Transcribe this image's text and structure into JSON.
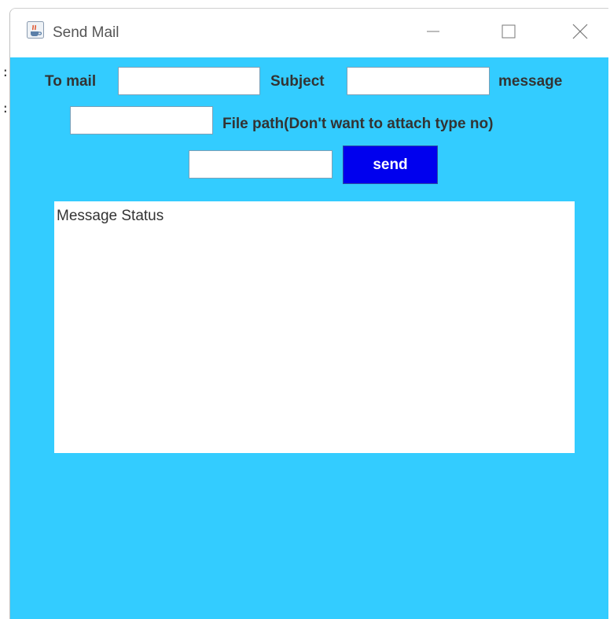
{
  "window": {
    "title": "Send Mail",
    "bg_color": "#33ccff"
  },
  "form": {
    "to_mail_label": "To mail",
    "to_mail_value": "",
    "subject_label": "Subject",
    "subject_value": "",
    "message_label": "message",
    "message_value": "",
    "file_path_label": "File path(Don't want to attach type no)",
    "file_path_value": "",
    "send_label": "send",
    "send_color": "#0000ee"
  },
  "status": {
    "text": "Message Status"
  },
  "icons": {
    "app": "java-coffee-icon",
    "minimize": "minimize-icon",
    "maximize": "maximize-icon",
    "close": "close-icon"
  }
}
